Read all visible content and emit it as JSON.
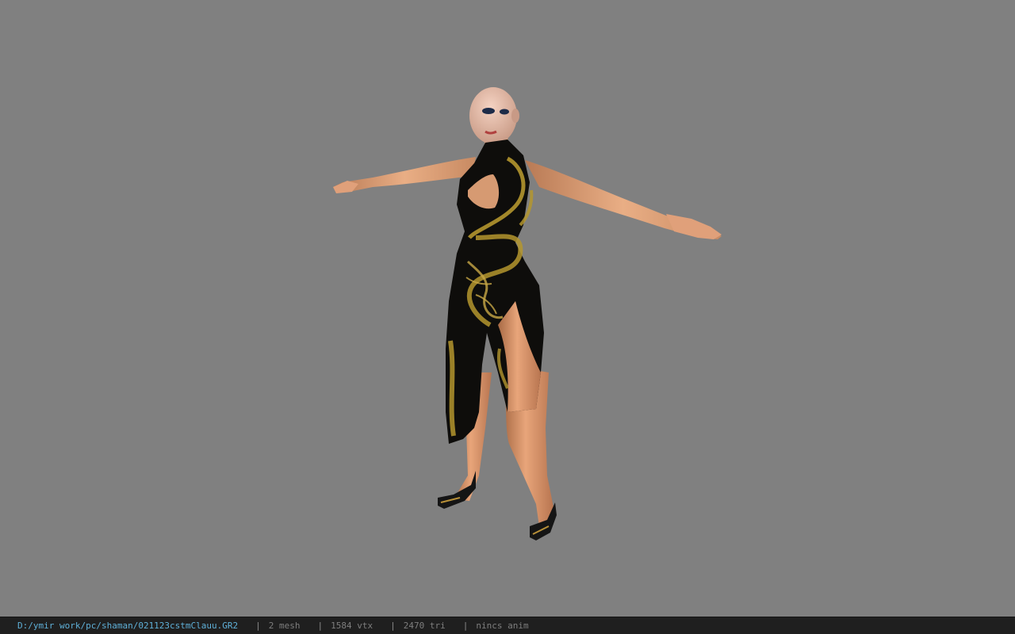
{
  "status_bar": {
    "file_path": "D:/ymir work/pc/shaman/021123cstmClauu.GR2",
    "separator": "|",
    "mesh": "2 mesh",
    "vertices": "1584 vtx",
    "triangles": "2470 tri",
    "animation": "nincs anim"
  },
  "viewport": {
    "background_color": "#808080",
    "model_icon": "character-model"
  },
  "colors": {
    "path_text": "#5fb0d8",
    "info_text": "#7e7e7e",
    "status_bar_bg": "#1f1f1f"
  }
}
